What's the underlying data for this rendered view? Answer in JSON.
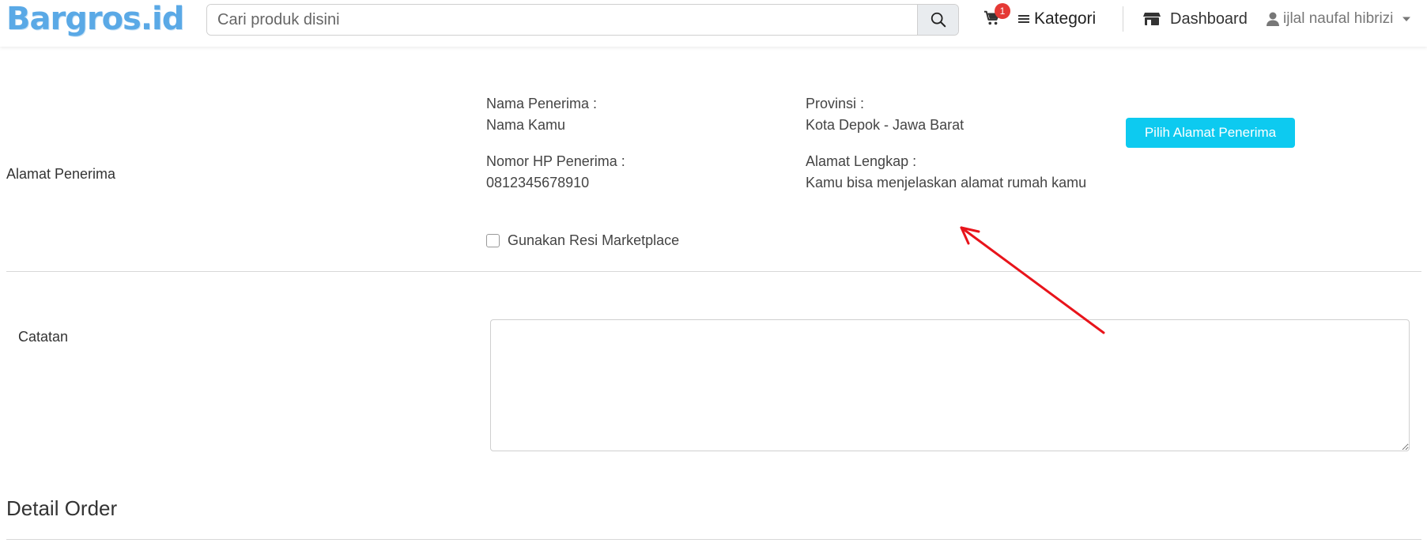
{
  "header": {
    "logo_text": "Bargros.id",
    "search_placeholder": "Cari produk disini",
    "cart_count": "1",
    "kategori_label": "Kategori",
    "dashboard_label": "Dashboard",
    "user_name": "ijlal naufal hibrizi"
  },
  "address": {
    "section_label": "Alamat Penerima",
    "recipient_name_label": "Nama Penerima :",
    "recipient_name_value": "Nama Kamu",
    "phone_label": "Nomor HP Penerima :",
    "phone_value": "0812345678910",
    "province_label": "Provinsi :",
    "province_value": "Kota Depok - Jawa Barat",
    "full_address_label": "Alamat Lengkap :",
    "full_address_value": "Kamu bisa menjelaskan alamat rumah kamu",
    "choose_button": "Pilih Alamat Penerima",
    "marketplace_checkbox_label": "Gunakan Resi Marketplace"
  },
  "notes": {
    "label": "Catatan",
    "value": ""
  },
  "order": {
    "title": "Detail Order"
  },
  "colors": {
    "logo": "#5aa9e6",
    "accent_button": "#0dcaf0",
    "badge": "#e53935",
    "annotation_arrow": "#e8141b"
  }
}
